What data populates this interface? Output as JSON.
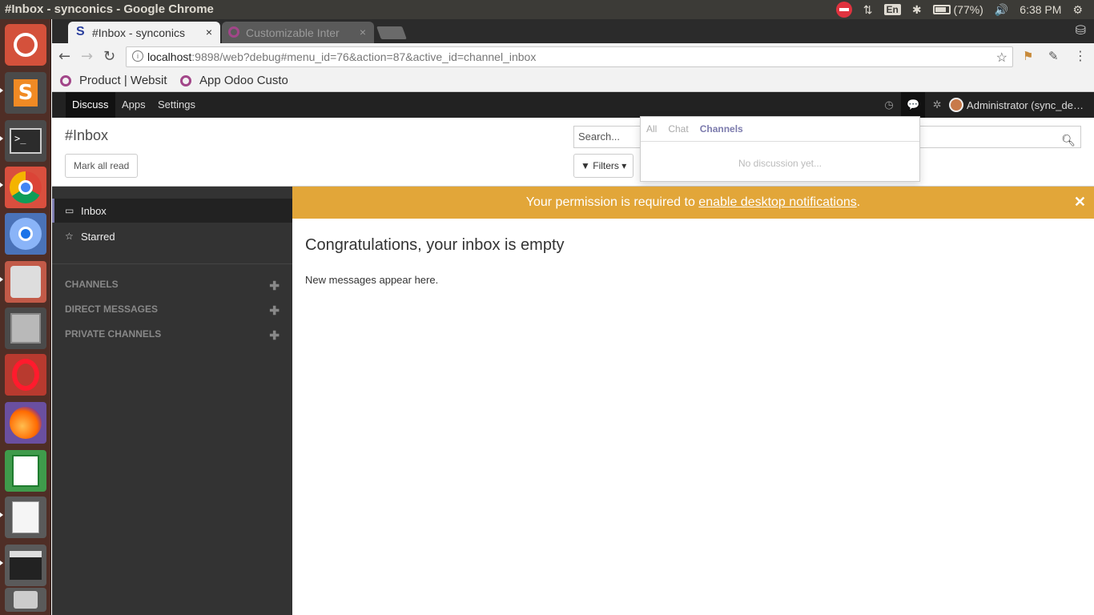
{
  "os": {
    "window_title": "#Inbox - synconics - Google Chrome",
    "keyboard_layout": "En",
    "battery": "(77%)",
    "clock": "6:38 PM"
  },
  "browser": {
    "tabs": [
      {
        "label": "#Inbox - synconics",
        "close": "×"
      },
      {
        "label": "Customizable Inter",
        "close": "×"
      }
    ],
    "url_host": "localhost",
    "url_rest": ":9898/web?debug#menu_id=76&action=87&active_id=channel_inbox",
    "bookmarks": [
      {
        "label": "Product | Websit"
      },
      {
        "label": "App Odoo Custo"
      }
    ]
  },
  "odoo": {
    "menus": [
      {
        "label": "Discuss"
      },
      {
        "label": "Apps"
      },
      {
        "label": "Settings"
      }
    ],
    "user": "Administrator (sync_de…",
    "control_panel": {
      "title": "#Inbox",
      "mark_all_read": "Mark all read",
      "search_placeholder": "Search...",
      "filters": "Filters ▾"
    },
    "dropdown": {
      "tabs": [
        {
          "label": "All"
        },
        {
          "label": "Chat"
        },
        {
          "label": "Channels"
        }
      ],
      "empty": "No discussion yet..."
    },
    "sidebar": {
      "items": [
        {
          "label": "Inbox"
        },
        {
          "label": "Starred"
        }
      ],
      "sections": [
        {
          "label": "CHANNELS"
        },
        {
          "label": "DIRECT MESSAGES"
        },
        {
          "label": "PRIVATE CHANNELS"
        }
      ]
    },
    "banner": {
      "prefix": "Your permission is required to ",
      "link": "enable desktop notifications",
      "suffix": "."
    },
    "main": {
      "heading": "Congratulations, your inbox is empty",
      "text": "New messages appear here."
    }
  },
  "colors": {
    "banner": "#e2a639",
    "accent": "#7c7bad",
    "sidebar": "#333333",
    "navbar": "#222222"
  }
}
